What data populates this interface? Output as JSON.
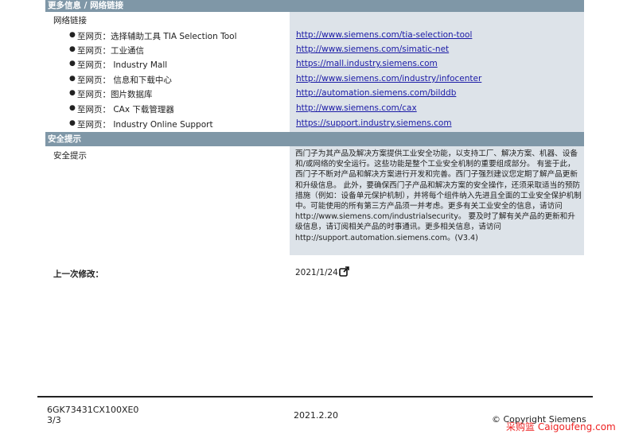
{
  "header": {
    "title": "更多信息 / 网络链接"
  },
  "network_links": {
    "label": "网络链接",
    "items": [
      {
        "label": "至网页：选择辅助工具 TIA Selection Tool",
        "url": "http://www.siemens.com/tia-selection-tool"
      },
      {
        "label": "至网页：工业通信",
        "url": "http://www.siemens.com/simatic-net"
      },
      {
        "label": "至网页：  Industry Mall",
        "url": "https://mall.industry.siemens.com"
      },
      {
        "label": "至网页：  信息和下载中心",
        "url": "http://www.siemens.com/industry/infocenter"
      },
      {
        "label": "至网页：图片数据库",
        "url": "http://automation.siemens.com/bilddb"
      },
      {
        "label": "至网页：  CAx 下载管理器",
        "url": "http://www.siemens.com/cax"
      },
      {
        "label": "至网页：  Industry Online Support",
        "url": "https://support.industry.siemens.com"
      }
    ]
  },
  "security": {
    "section_title": "安全提示",
    "label": "安全提示",
    "text": "西门子为其产品及解决方案提供工业安全功能，以支持工厂、解决方案、机器、设备和/或网络的安全运行。这些功能是整个工业安全机制的重要组成部分。 有鉴于此，西门子不断对产品和解决方案进行开发和完善。西门子强烈建议您定期了解产品更新和升级信息。 此外，要确保西门子产品和解决方案的安全操作，还须采取适当的预防措施（例如：设备单元保护机制），并将每个组件纳入先进且全面的工业安全保护机制中。可能使用的所有第三方产品须一并考虑。更多有关工业安全的信息，请访问 http://www.siemens.com/industrialsecurity。 要及时了解有关产品的更新和升级信息，请订阅相关产品的时事通讯。更多相关信息，请访问 http://support.automation.siemens.com。(V3.4)"
  },
  "last_modified": {
    "label": "上一次修改：",
    "date": "2021/1/24",
    "icon": "external-link-icon"
  },
  "footer": {
    "doc_id": "6GK73431CX100XE0",
    "page": "3/3",
    "date": "2021.2.20",
    "copyright": "© Copyright Siemens",
    "watermark": "采购篮 Caigoufeng.com"
  },
  "colors": {
    "bar": "#7f97a7",
    "panel": "#dde3e9",
    "link": "#1a1aa6",
    "watermark": "#ee2222"
  }
}
